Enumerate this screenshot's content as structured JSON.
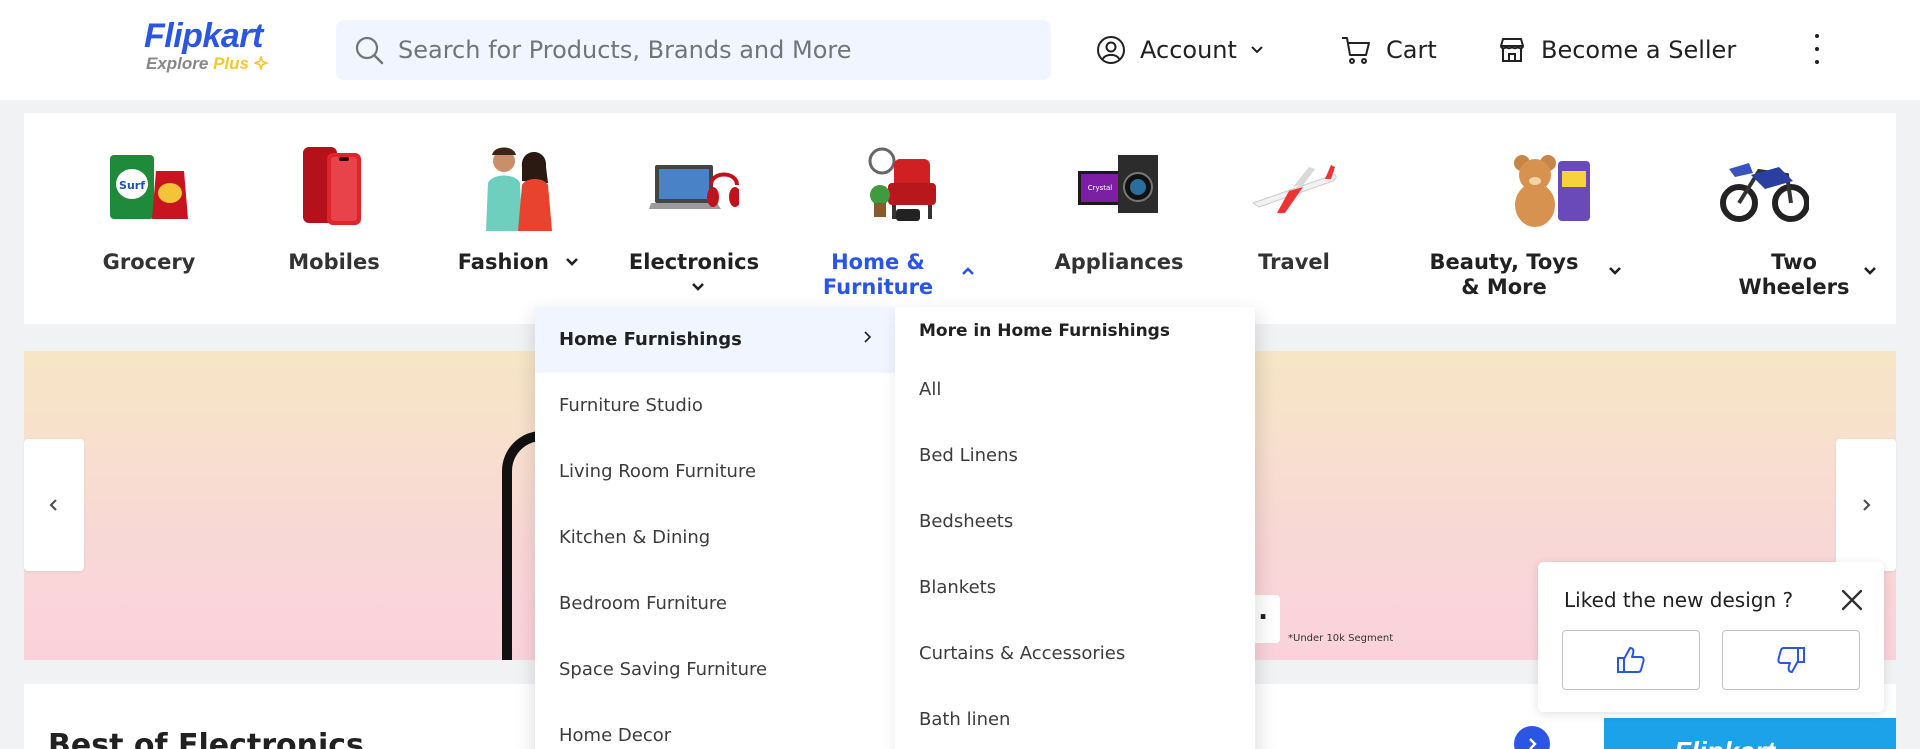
{
  "header": {
    "logo_text": "Flipkart",
    "logo_sub": "Explore",
    "logo_plus": "Plus",
    "search_placeholder": "Search for Products, Brands and More",
    "account_label": "Account",
    "cart_label": "Cart",
    "seller_label": "Become a Seller",
    "brand_color": "#2a55e5"
  },
  "categories": [
    {
      "name": "Grocery",
      "icon": "grocery-image"
    },
    {
      "name": "Mobiles",
      "icon": "mobiles-image"
    },
    {
      "name": "Fashion",
      "icon": "fashion-image",
      "has_dropdown": true
    },
    {
      "name": "Electronics",
      "icon": "electronics-image",
      "has_dropdown": true
    },
    {
      "name": "Home & Furniture",
      "icon": "home-furniture-image",
      "has_dropdown": true,
      "selected": true
    },
    {
      "name": "Appliances",
      "icon": "appliances-image"
    },
    {
      "name": "Travel",
      "icon": "travel-image"
    },
    {
      "name": "Beauty, Toys & More",
      "icon": "beauty-toys-image",
      "has_dropdown": true
    },
    {
      "name": "Two Wheelers",
      "icon": "two-wheelers-image",
      "has_dropdown": true
    }
  ],
  "banner": {
    "note": "*Under 10k Segment",
    "box_text": "."
  },
  "menu": {
    "left_items": [
      {
        "label": "Home Furnishings",
        "active": true
      },
      {
        "label": "Furniture Studio"
      },
      {
        "label": "Living Room Furniture"
      },
      {
        "label": "Kitchen & Dining"
      },
      {
        "label": "Bedroom Furniture"
      },
      {
        "label": "Space Saving Furniture"
      },
      {
        "label": "Home Decor"
      }
    ],
    "right_title": "More in Home Furnishings",
    "right_items": [
      "All",
      "Bed Linens",
      "Bedsheets",
      "Blankets",
      "Curtains & Accessories",
      "Bath linen"
    ]
  },
  "section": {
    "title": "Best of Electronics"
  },
  "promo": {
    "text": "Flipkart"
  },
  "feedback": {
    "question": "Liked the new design ?"
  }
}
